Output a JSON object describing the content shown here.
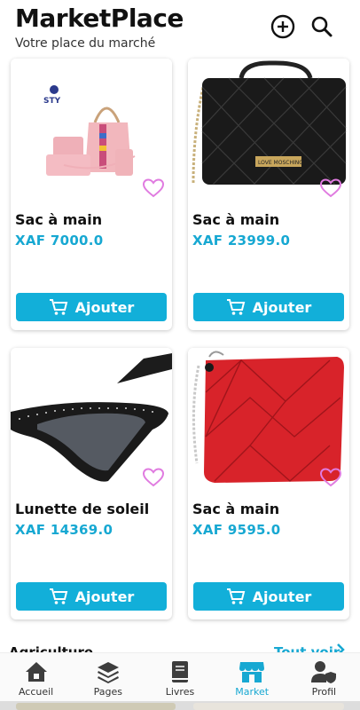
{
  "header": {
    "title": "MarketPlace",
    "subtitle": "Votre place du marché",
    "add_icon": "plus-circle-icon",
    "search_icon": "search-icon"
  },
  "products": [
    {
      "name": "Sac à main",
      "price": "XAF 7000.0",
      "button": "Ajouter",
      "image": "pink-handbag-set",
      "brand_text": "STY"
    },
    {
      "name": "Sac à main",
      "price": "XAF 23999.0",
      "button": "Ajouter",
      "image": "black-quilted-bag",
      "brand_text": "LOVE MOSCHINO"
    },
    {
      "name": "Lunette de soleil",
      "price": "XAF 14369.0",
      "button": "Ajouter",
      "image": "cat-eye-sunglasses"
    },
    {
      "name": "Sac à main",
      "price": "XAF 9595.0",
      "button": "Ajouter",
      "image": "red-quilted-bag"
    }
  ],
  "section": {
    "title": "Agriculture",
    "see_all": "Tout voir"
  },
  "nav": [
    {
      "label": "Accueil",
      "icon": "home-icon",
      "active": false
    },
    {
      "label": "Pages",
      "icon": "layers-icon",
      "active": false
    },
    {
      "label": "Livres",
      "icon": "book-icon",
      "active": false
    },
    {
      "label": "Market",
      "icon": "store-icon",
      "active": true
    },
    {
      "label": "Profil",
      "icon": "user-shield-icon",
      "active": false
    }
  ],
  "colors": {
    "accent": "#17a8d2",
    "button": "#12afd9",
    "favorite": "#e07be0"
  }
}
